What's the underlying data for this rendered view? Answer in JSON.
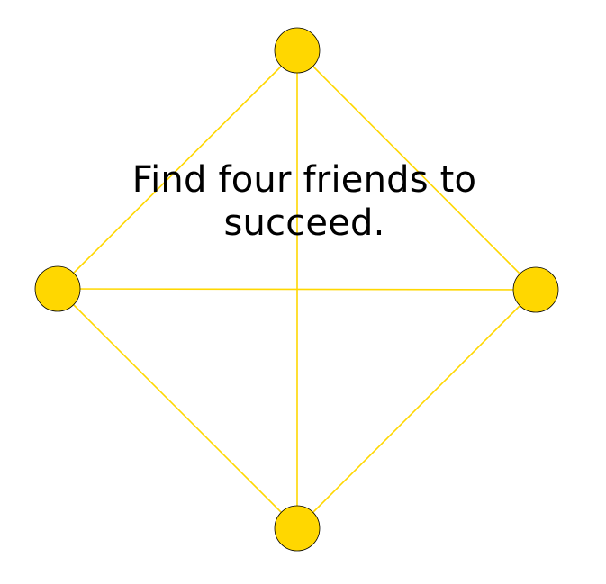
{
  "diagram": {
    "caption_lines": [
      "Find four friends to",
      "succeed."
    ],
    "colors": {
      "node_fill": "#FFD700",
      "edge": "#FFD700",
      "node_outline": "#000000"
    },
    "nodes": [
      {
        "id": "top"
      },
      {
        "id": "left"
      },
      {
        "id": "right"
      },
      {
        "id": "bottom"
      }
    ],
    "edges": [
      {
        "from": "top",
        "to": "left"
      },
      {
        "from": "top",
        "to": "right"
      },
      {
        "from": "top",
        "to": "bottom"
      },
      {
        "from": "left",
        "to": "right"
      },
      {
        "from": "left",
        "to": "bottom"
      },
      {
        "from": "right",
        "to": "bottom"
      }
    ]
  }
}
